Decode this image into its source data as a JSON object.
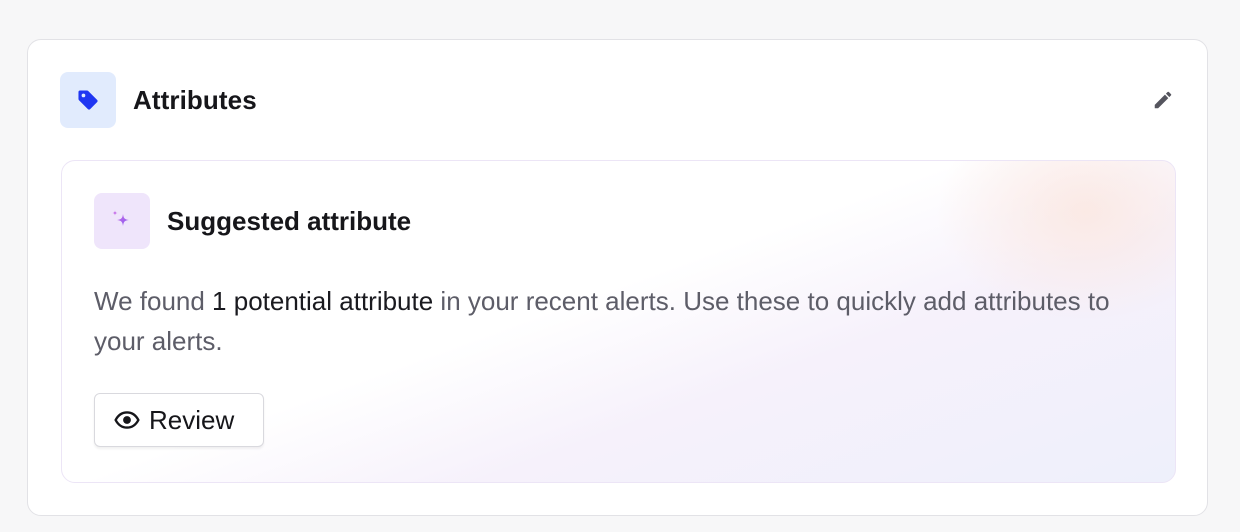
{
  "attributes_card": {
    "title": "Attributes",
    "icon": "tag-icon",
    "edit_icon": "pencil-icon",
    "colors": {
      "icon_bg": "#e1ebfd",
      "icon_fg": "#1f36f2"
    }
  },
  "suggestion": {
    "title": "Suggested attribute",
    "icon": "sparkle-icon",
    "text_before": "We found ",
    "text_highlight": "1 potential attribute",
    "text_after": " in your recent alerts. Use these to quickly add attributes to your alerts.",
    "review_button": {
      "label": "Review",
      "icon": "eye-icon"
    },
    "colors": {
      "icon_bg": "#efe5fb",
      "icon_fg": "#a06cf0"
    }
  }
}
